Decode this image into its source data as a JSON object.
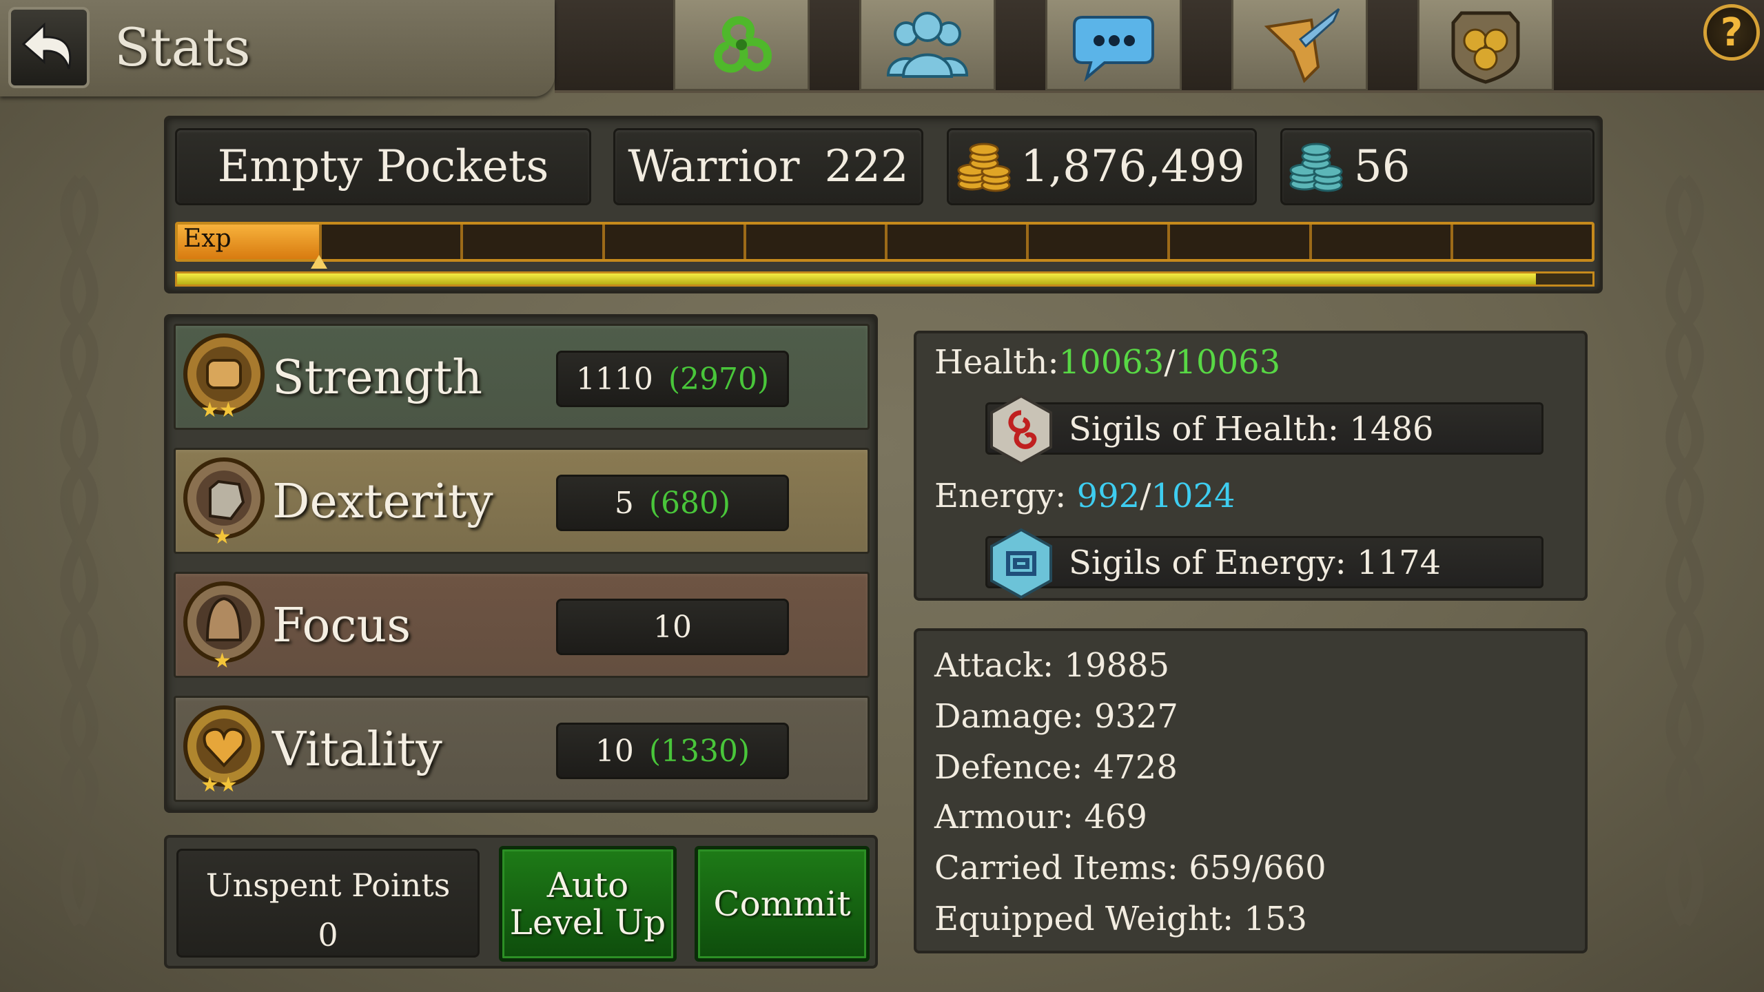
{
  "header": {
    "title": "Stats",
    "nav_icons": [
      "triskelion-icon",
      "party-icon",
      "chat-icon",
      "quest-scroll-icon",
      "guild-shield-icon"
    ],
    "help_label": "?"
  },
  "character": {
    "name": "Empty Pockets",
    "class": "Warrior",
    "level": "222",
    "gold": "1,876,499",
    "platinum": "56"
  },
  "experience": {
    "label": "Exp",
    "segment_progress": 1.0,
    "segments": 10,
    "overall_progress": 0.96
  },
  "stats": [
    {
      "name": "Strength",
      "base": "1110",
      "bonus": "(2970)",
      "icon": "strength-fist-icon",
      "color": "#4f5d4a"
    },
    {
      "name": "Dexterity",
      "base": "5",
      "bonus": "(680)",
      "icon": "dexterity-gauntlet-icon",
      "color": "#8a7a52"
    },
    {
      "name": "Focus",
      "base": "10",
      "bonus": "",
      "icon": "focus-helmet-icon",
      "color": "#6e5443"
    },
    {
      "name": "Vitality",
      "base": "10",
      "bonus": "(1330)",
      "icon": "vitality-heart-icon",
      "color": "#625b4c"
    }
  ],
  "controls": {
    "unspent_label": "Unspent Points",
    "unspent_value": "0",
    "auto_level_line1": "Auto",
    "auto_level_line2": "Level Up",
    "commit_label": "Commit"
  },
  "vitals": {
    "health_label": "Health:",
    "health_current": "10063",
    "health_max": "10063",
    "health_sep": "/",
    "sigils_health_label": "Sigils of Health:",
    "sigils_health_value": "1486",
    "energy_label": "Energy:",
    "energy_current": "992",
    "energy_max": "1024",
    "energy_sep": "/",
    "sigils_energy_label": "Sigils of Energy:",
    "sigils_energy_value": "1174"
  },
  "attributes": [
    {
      "label": "Attack:",
      "value": "19885"
    },
    {
      "label": "Damage:",
      "value": "9327"
    },
    {
      "label": "Defence:",
      "value": "4728"
    },
    {
      "label": "Armour:",
      "value": "469"
    },
    {
      "label": "Carried Items:",
      "value": "659/660"
    },
    {
      "label": "Equipped Weight:",
      "value": "153"
    }
  ],
  "colors": {
    "health_green": "#58d845",
    "energy_cyan": "#3ecdf0",
    "bonus_green": "#49c63a",
    "exp_orange": "#f0a02c",
    "exp_yellow": "#e8df30",
    "button_green": "#1e7b17"
  }
}
